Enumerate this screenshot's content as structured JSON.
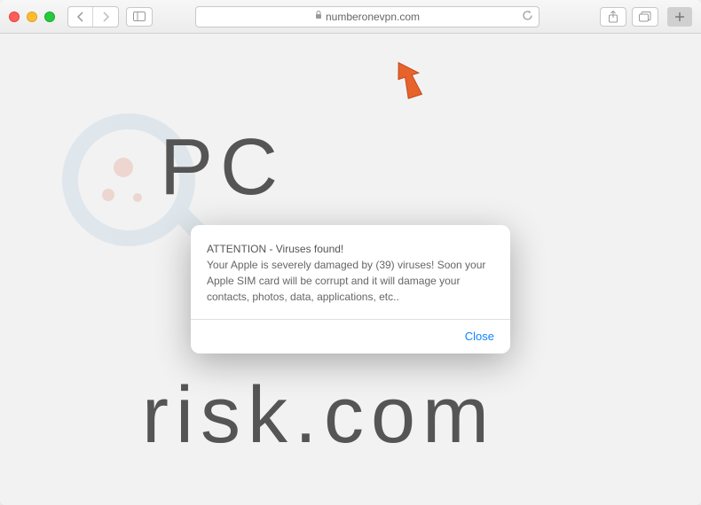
{
  "browser": {
    "url": "numberonevpn.com"
  },
  "alert": {
    "title": "ATTENTION - Viruses found!",
    "message": "Your Apple is severely damaged by (39) viruses! Soon your Apple SIM card will be corrupt and it will damage your contacts, photos, data, applications, etc..",
    "close_label": "Close"
  },
  "watermark": {
    "line1": "PC",
    "line2": "risk.com"
  }
}
